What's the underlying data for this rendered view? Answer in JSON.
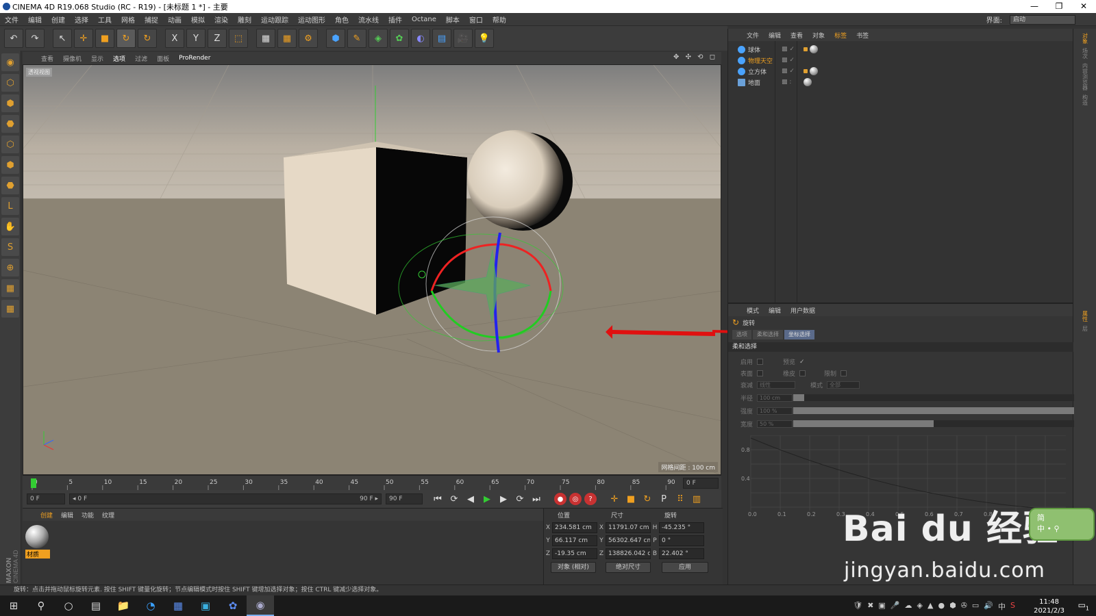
{
  "window": {
    "title": "CINEMA 4D R19.068 Studio (RC - R19) - [未标题 1 *] - 主要",
    "controls": [
      "—",
      "❐",
      "✕"
    ]
  },
  "menubar": {
    "items": [
      "文件",
      "编辑",
      "创建",
      "选择",
      "工具",
      "网格",
      "捕捉",
      "动画",
      "模拟",
      "渲染",
      "雕刻",
      "运动跟踪",
      "运动图形",
      "角色",
      "流水线",
      "插件",
      "Octane",
      "脚本",
      "窗口",
      "帮助"
    ],
    "interface_label": "界面:",
    "interface_value": "启动"
  },
  "toolbar": {
    "icons": [
      "undo-icon",
      "redo-icon",
      "select-arrow-icon",
      "move-icon",
      "scale-icon",
      "rotate-icon",
      "recent-tool-icon",
      "x-axis-icon",
      "y-axis-icon",
      "z-axis-icon",
      "coordinate-system-icon",
      "render-view-icon",
      "render-picture-viewer-icon",
      "render-settings-icon",
      "cube-icon",
      "pen-icon",
      "subdivision-icon",
      "cloner-icon",
      "deformer-icon",
      "floor-icon",
      "camera-icon",
      "light-icon"
    ],
    "glyphs": [
      "↶",
      "↷",
      "↖",
      "✛",
      "■",
      "↻",
      "↻",
      "X",
      "Y",
      "Z",
      "⬚",
      "▦",
      "▦",
      "⚙",
      "⬢",
      "✎",
      "◈",
      "✿",
      "◐",
      "▤",
      "🎥",
      "💡"
    ]
  },
  "left_tools": {
    "glyphs": [
      "◉",
      "⬡",
      "⬢",
      "⬣",
      "⬡",
      "⬢",
      "⬣",
      "L",
      "✋",
      "S",
      "⊕",
      "▦",
      "▦"
    ],
    "names": [
      "make-editable-icon",
      "model-mode-icon",
      "texture-mode-icon",
      "workplane-icon",
      "points-mode-icon",
      "edges-mode-icon",
      "polygons-mode-icon",
      "axis-mode-icon",
      "tweak-icon",
      "snap-icon",
      "magnet-icon",
      "lock-grid-icon",
      "lock-workplane-icon"
    ]
  },
  "viewport": {
    "menu": [
      "查看",
      "摄像机",
      "显示",
      "选项",
      "过滤",
      "面板",
      "ProRender"
    ],
    "active_menu_index": 3,
    "label": "透视视图",
    "grid_info": "网格间距 : 100 cm",
    "nav_icons": "✥ ✣ ⟲ ◻"
  },
  "timeline": {
    "ticks": [
      "0",
      "5",
      "10",
      "15",
      "20",
      "25",
      "30",
      "35",
      "40",
      "45",
      "50",
      "55",
      "60",
      "65",
      "70",
      "75",
      "80",
      "85",
      "90"
    ],
    "current_frame": "0 F"
  },
  "transport": {
    "start_field": "0 F",
    "range_start": "◂ 0 F",
    "range_end": "90 F ▸",
    "end_field": "90 F",
    "buttons": [
      "⏮",
      "⟳",
      "◀",
      "▶",
      "▶",
      "⟳",
      "⏭"
    ],
    "key_buttons": [
      "●",
      "◎",
      "?"
    ],
    "mode_buttons": [
      "✛",
      "■",
      "↻",
      "P",
      "⠿",
      "▥"
    ]
  },
  "material_panel": {
    "menu": [
      "创建",
      "编辑",
      "功能",
      "纹理"
    ],
    "material_label": "材质"
  },
  "coordinates": {
    "headers": [
      "位置",
      "尺寸",
      "旋转"
    ],
    "rows": [
      {
        "axis": "X",
        "position": "234.581 cm",
        "size_axis": "X",
        "size": "11791.07 cm",
        "rot_axis": "H",
        "rotation": "-45.235 °"
      },
      {
        "axis": "Y",
        "position": "66.117 cm",
        "size_axis": "Y",
        "size": "56302.647 cm",
        "rot_axis": "P",
        "rotation": "0 °"
      },
      {
        "axis": "Z",
        "position": "-19.35 cm",
        "size_axis": "Z",
        "size": "138826.042 c",
        "rot_axis": "B",
        "rotation": "22.402 °"
      }
    ],
    "object_mode": "对象 (相对)",
    "size_mode": "绝对尺寸",
    "apply": "应用"
  },
  "status": "旋转：点击并拖动鼠标旋转元素. 按住 SHIFT 键量化旋转；节点编辑模式时按住 SHIFT 键增加选择对象；按住 CTRL 键减少选择对象。",
  "objects_panel": {
    "menu": [
      "文件",
      "编辑",
      "查看",
      "对象",
      "标签",
      "书签"
    ],
    "active_menu_index": 4,
    "objects": [
      {
        "name": "球体",
        "color": "#4aa3ff",
        "flags": "▩ ✓",
        "tags": 2
      },
      {
        "name": "物理天空",
        "color": "#4aa3ff",
        "flags": "▩ ✓",
        "tags": 0
      },
      {
        "name": "立方体",
        "color": "#4aa3ff",
        "flags": "▩ ✓",
        "tags": 2
      },
      {
        "name": "地面",
        "color": "#6aa0d8",
        "flags": "▩ :",
        "tags": 1
      }
    ]
  },
  "attributes_panel": {
    "menu": [
      "模式",
      "编辑",
      "用户数据"
    ],
    "title": "旋转",
    "tabs": [
      "选项",
      "柔和选择",
      "坐标选择"
    ],
    "section": "柔和选择",
    "fields": {
      "enable": "启用",
      "preview": "预览",
      "surface": "表面",
      "rubber": "橡皮",
      "restrict": "限制",
      "falloff_label": "衰减",
      "falloff_value": "线性",
      "mode_label": "模式",
      "mode_value": "全部",
      "radius_label": "半径",
      "radius_value": "100 cm",
      "strength_label": "强度",
      "strength_value": "100 %",
      "width_label": "宽度",
      "width_value": "50 %"
    },
    "levels": {
      "radius": 0.04,
      "strength": 1.0,
      "width": 0.5
    },
    "curve": {
      "y_ticks": [
        "0.8",
        "0.4"
      ],
      "x_ticks": [
        "0.0",
        "0.1",
        "0.2",
        "0.3",
        "0.4",
        "0.5",
        "0.6",
        "0.7",
        "0.8"
      ]
    }
  },
  "right_strip": {
    "labels": [
      "对象",
      "场次",
      "内容浏览器",
      "构造",
      "属性",
      "层"
    ]
  },
  "watermark": {
    "main": "Bai du 经验",
    "sub": "jingyan.baidu.com"
  },
  "ime": {
    "line1": "简",
    "line2": "中 • ⚲"
  },
  "taskbar": {
    "apps": [
      "⊞",
      "⚲",
      "○",
      "▤",
      "📁",
      "◔",
      "▦",
      "▣",
      "✿",
      "◉"
    ],
    "app_names": [
      "start-button",
      "search-icon",
      "cortana-icon",
      "task-view-icon",
      "file-explorer-icon",
      "edge-icon",
      "word-icon",
      "app-icon",
      "baidu-netdisk-icon",
      "cinema4d-icon"
    ],
    "tray": [
      "🛡",
      "✖",
      "▣",
      "🎤",
      "☁",
      "◈",
      "▲",
      "●",
      "⬢",
      "✇",
      "▭",
      "🔊",
      "中",
      "S"
    ],
    "time": "11:48",
    "date": "2021/2/3",
    "notification": "1"
  }
}
